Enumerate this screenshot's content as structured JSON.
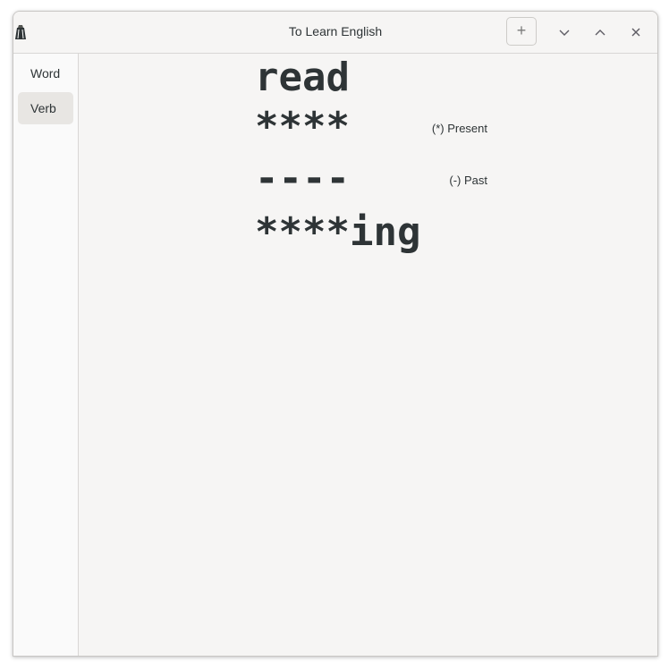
{
  "window": {
    "title": "To Learn English",
    "add_button": "+"
  },
  "sidebar": {
    "items": [
      {
        "label": "Word",
        "active": false
      },
      {
        "label": "Verb",
        "active": true
      }
    ]
  },
  "verb": {
    "word": "read",
    "present": "****",
    "present_hint": "(*) Present",
    "past": "----",
    "past_hint": "(-) Past",
    "gerund": "****ing"
  },
  "icons": {
    "app": "app-icon",
    "minimize": "chevron-down-icon",
    "maximize": "chevron-up-icon",
    "close": "close-icon"
  }
}
